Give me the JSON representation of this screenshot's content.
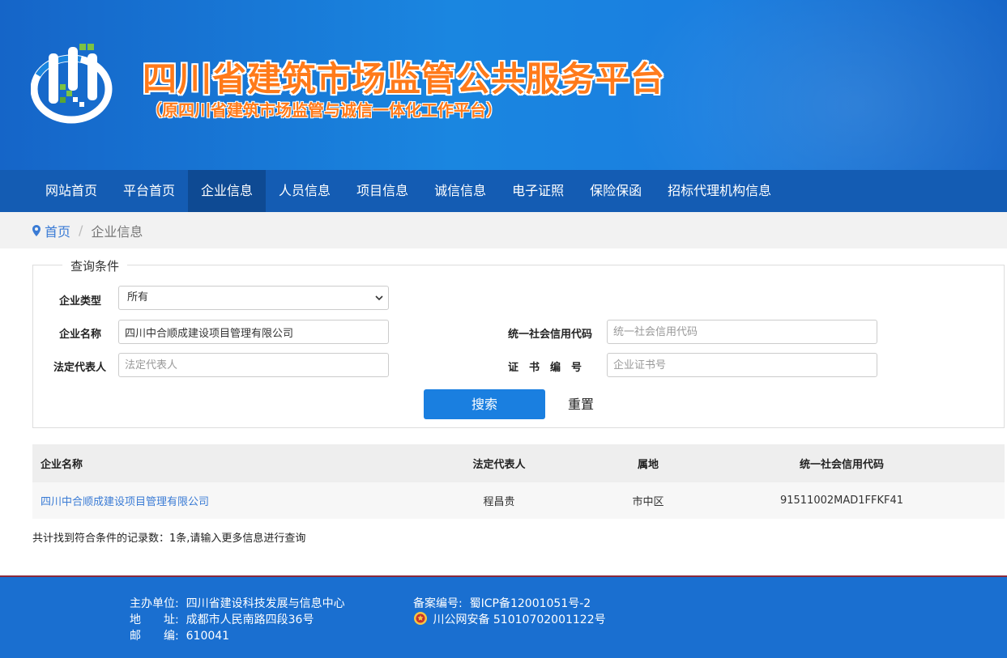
{
  "header": {
    "title": "四川省建筑市场监管公共服务平台",
    "subtitle": "（原四川省建筑市场监管与诚信一体化工作平台）",
    "logo": "logo-icon"
  },
  "nav": {
    "items": [
      {
        "label": "网站首页"
      },
      {
        "label": "平台首页"
      },
      {
        "label": "企业信息"
      },
      {
        "label": "人员信息"
      },
      {
        "label": "项目信息"
      },
      {
        "label": "诚信信息"
      },
      {
        "label": "电子证照"
      },
      {
        "label": "保险保函"
      },
      {
        "label": "招标代理机构信息"
      }
    ],
    "active": "企业信息"
  },
  "breadcrumb": {
    "home": "首页",
    "separator": "/",
    "current": "企业信息"
  },
  "query": {
    "legend": "查询条件",
    "company_type_label": "企业类型",
    "company_type_value": "所有",
    "company_name_label": "企业名称",
    "company_name_value": "四川中合顺成建设项目管理有限公司",
    "credit_code_label": "统一社会信用代码",
    "credit_code_placeholder": "统一社会信用代码",
    "legal_rep_label": "法定代表人",
    "legal_rep_placeholder": "法定代表人",
    "cert_no_label": "证　书　编　号",
    "cert_no_placeholder": "企业证书号",
    "search_label": "搜索",
    "reset_label": "重置"
  },
  "results": {
    "columns": [
      "企业名称",
      "法定代表人",
      "属地",
      "统一社会信用代码"
    ],
    "rows": [
      [
        "四川中合顺成建设项目管理有限公司",
        "程昌贵",
        "市中区",
        "91511002MAD1FFKF41"
      ]
    ],
    "summary": "共计找到符合条件的记录数：1条,请输入更多信息进行查询"
  },
  "footer": {
    "host_label": "主办单位:",
    "host_value": "四川省建设科技发展与信息中心",
    "address_label": "地　　址:",
    "address_value": "成都市人民南路四段36号",
    "postcode_label": "邮　　编:",
    "postcode_value": "610041",
    "icp_label": "备案编号:",
    "icp_value": "蜀ICP备12001051号-2",
    "police_value": "川公网安备 51010702001122号"
  },
  "colors": {
    "banner": "#1a86e0",
    "nav": "#145cb3",
    "nav_active": "#0e4a93",
    "title": "#ff7a1a",
    "link": "#3a7bd5",
    "button": "#1a7fe0",
    "footer": "#1a6fd0"
  }
}
